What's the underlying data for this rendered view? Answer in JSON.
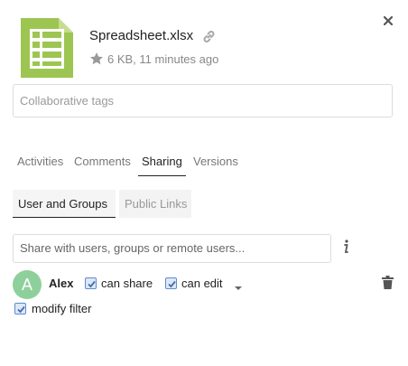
{
  "file": {
    "name": "Spreadsheet.xlsx",
    "meta": "6 KB, 11 minutes ago",
    "icon": "spreadsheet-file-icon",
    "icon_color": "#9dc552"
  },
  "tags": {
    "placeholder": "Collaborative tags"
  },
  "tabs": [
    {
      "label": "Activities",
      "active": false
    },
    {
      "label": "Comments",
      "active": false
    },
    {
      "label": "Sharing",
      "active": true
    },
    {
      "label": "Versions",
      "active": false
    }
  ],
  "subtabs": [
    {
      "label": "User and Groups",
      "active": true
    },
    {
      "label": "Public Links",
      "active": false
    }
  ],
  "share": {
    "placeholder": "Share with users, groups or remote users..."
  },
  "share_entry": {
    "avatar_letter": "A",
    "avatar_color": "#8ed09b",
    "username": "Alex",
    "can_share_label": "can share",
    "can_share_checked": true,
    "can_edit_label": "can edit",
    "can_edit_checked": true,
    "modify_filter_label": "modify filter",
    "modify_filter_checked": true
  }
}
